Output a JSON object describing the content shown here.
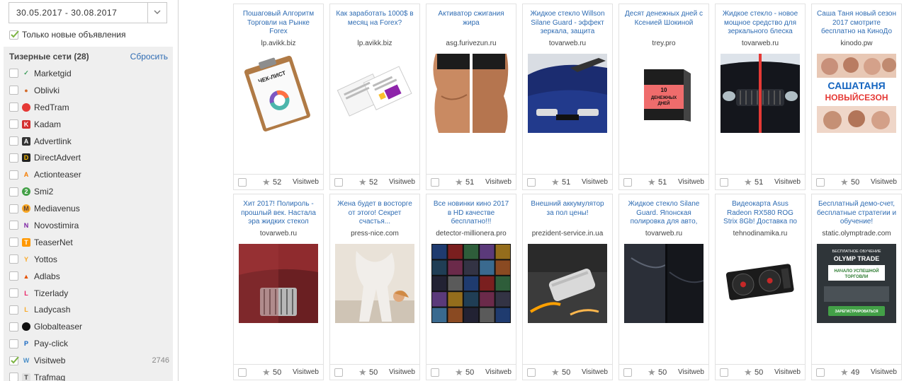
{
  "date_range": {
    "value": "30.05.2017 - 30.08.2017"
  },
  "filter": {
    "only_new_label": "Только новые объявления",
    "only_new_checked": true
  },
  "networks": {
    "heading": "Тизерные сети (28)",
    "reset_label": "Сбросить",
    "items": [
      {
        "name": "Marketgid",
        "icon": "marketgid-icon",
        "checked": false,
        "count": ""
      },
      {
        "name": "Oblivki",
        "icon": "oblivki-icon",
        "checked": false,
        "count": ""
      },
      {
        "name": "RedTram",
        "icon": "redtram-icon",
        "checked": false,
        "count": ""
      },
      {
        "name": "Kadam",
        "icon": "kadam-icon",
        "checked": false,
        "count": ""
      },
      {
        "name": "Advertlink",
        "icon": "advertlink-icon",
        "checked": false,
        "count": ""
      },
      {
        "name": "DirectAdvert",
        "icon": "directadvert-icon",
        "checked": false,
        "count": ""
      },
      {
        "name": "Actionteaser",
        "icon": "actionteaser-icon",
        "checked": false,
        "count": ""
      },
      {
        "name": "Smi2",
        "icon": "smi2-icon",
        "checked": false,
        "count": ""
      },
      {
        "name": "Mediavenus",
        "icon": "mediavenus-icon",
        "checked": false,
        "count": ""
      },
      {
        "name": "Novostimira",
        "icon": "novostimira-icon",
        "checked": false,
        "count": ""
      },
      {
        "name": "TeaserNet",
        "icon": "teasernet-icon",
        "checked": false,
        "count": ""
      },
      {
        "name": "Yottos",
        "icon": "yottos-icon",
        "checked": false,
        "count": ""
      },
      {
        "name": "Adlabs",
        "icon": "adlabs-icon",
        "checked": false,
        "count": ""
      },
      {
        "name": "Tizerlady",
        "icon": "tizerlady-icon",
        "checked": false,
        "count": ""
      },
      {
        "name": "Ladycash",
        "icon": "ladycash-icon",
        "checked": false,
        "count": ""
      },
      {
        "name": "Globalteaser",
        "icon": "globalteaser-icon",
        "checked": false,
        "count": ""
      },
      {
        "name": "Pay-click",
        "icon": "payclick-icon",
        "checked": false,
        "count": ""
      },
      {
        "name": "Visitweb",
        "icon": "visitweb-icon",
        "checked": true,
        "count": "2746"
      },
      {
        "name": "Trafmag",
        "icon": "trafmag-icon",
        "checked": false,
        "count": ""
      }
    ]
  },
  "ads": [
    {
      "title": "Пошаговый Алгоритм Торговли на Рынке Forex",
      "domain": "lp.avikk.biz",
      "likes": "52",
      "source": "Visitweb",
      "image": "clipboard-checklist"
    },
    {
      "title": "Как заработать 1000$ в месяц на Forex?",
      "domain": "lp.avikk.biz",
      "likes": "52",
      "source": "Visitweb",
      "image": "booklet-pages"
    },
    {
      "title": "Активатор сжигания жира",
      "domain": "asg.furivezun.ru",
      "likes": "51",
      "source": "Visitweb",
      "image": "bodies-photo"
    },
    {
      "title": "Жидкое стекло Willson Silane Guard - эффект зеркала, защита",
      "domain": "tovarweb.ru",
      "likes": "51",
      "source": "Visitweb",
      "image": "blue-car-polish"
    },
    {
      "title": "Десят денежных дней с Ксенией Шокиной",
      "domain": "trey.pro",
      "likes": "51",
      "source": "Visitweb",
      "image": "product-box"
    },
    {
      "title": "Жидкое стекло - новое мощное средство для зеркального блеска",
      "domain": "tovarweb.ru",
      "likes": "51",
      "source": "Visitweb",
      "image": "car-front-split"
    },
    {
      "title": "Саша Таня новый сезон 2017 смотрите бесплатно на КиноДо",
      "domain": "kinodo.pw",
      "likes": "50",
      "source": "Visitweb",
      "image": "tv-show-poster"
    },
    {
      "title": "Хит 2017! Полироль - прошлый век. Настала эра жидких стекол",
      "domain": "tovarweb.ru",
      "likes": "50",
      "source": "Visitweb",
      "image": "red-car-grille"
    },
    {
      "title": "Жена будет в восторге от этого! Секрет счастья...",
      "domain": "press-nice.com",
      "likes": "50",
      "source": "Visitweb",
      "image": "woman-pose"
    },
    {
      "title": "Все новинки кино 2017 в HD качестве бесплатно!!!",
      "domain": "detector-millionera.pro",
      "likes": "50",
      "source": "Visitweb",
      "image": "movie-posters-grid"
    },
    {
      "title": "Внешний аккумулятор за пол цены!",
      "domain": "prezident-service.in.ua",
      "likes": "50",
      "source": "Visitweb",
      "image": "power-bank"
    },
    {
      "title": "Жидкое стекло Silane Guard. Японская полировка для авто,",
      "domain": "tovarweb.ru",
      "likes": "50",
      "source": "Visitweb",
      "image": "dark-car-panel"
    },
    {
      "title": "Видеокарта Asus Radeon RX580 ROG Strix 8Gb! Доставка по",
      "domain": "tehnodinamika.ru",
      "likes": "50",
      "source": "Visitweb",
      "image": "graphics-card"
    },
    {
      "title": "Бесплатный демо-счет, бесплатные стратегии и обучение!",
      "domain": "static.olymptrade.com",
      "likes": "49",
      "source": "Visitweb",
      "image": "olymp-trade-banner"
    }
  ],
  "image_text": {
    "tvshow_line1": "САШАТАНЯ",
    "tvshow_line2": "НОВЫЙСЕЗОН",
    "box_line1": "10",
    "box_line2": "ДЕНЕЖНЫХ",
    "box_line3": "ДНЕЙ",
    "clip_label": "ЧЕК-ЛИСТ",
    "olymp_top": "БЕСПЛАТНОЕ ОБУЧЕНИЕ",
    "olymp_brand": "OLYMP TRADE",
    "olymp_mid1": "НАЧАЛО УСПЕШНОЙ",
    "olymp_mid2": "ТОРГОВЛИ",
    "olymp_btn": "ЗАРЕГИСТРИРОВАТЬСЯ"
  },
  "colors": {
    "link": "#2f6cb3",
    "check": "#7cb342",
    "panel": "#efefef"
  }
}
